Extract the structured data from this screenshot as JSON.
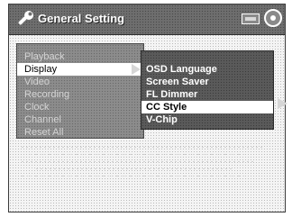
{
  "window": {
    "title": "General Setting",
    "icon": "wrench-icon",
    "indicators": [
      "disc-icon",
      "ring-icon"
    ]
  },
  "main_menu": {
    "items": [
      {
        "label": "Playback",
        "selected": false
      },
      {
        "label": "Display",
        "selected": true
      },
      {
        "label": "Video",
        "selected": false
      },
      {
        "label": "Recording",
        "selected": false
      },
      {
        "label": "Clock",
        "selected": false
      },
      {
        "label": "Channel",
        "selected": false
      },
      {
        "label": "Reset All",
        "selected": false
      }
    ]
  },
  "sub_menu": {
    "items": [
      {
        "label": "OSD Language",
        "selected": false
      },
      {
        "label": "Screen Saver",
        "selected": false
      },
      {
        "label": "FL Dimmer",
        "selected": false
      },
      {
        "label": "CC Style",
        "selected": true
      },
      {
        "label": "V-Chip",
        "selected": false
      }
    ]
  },
  "colors": {
    "title_bar": "#6e6e6e",
    "menu_panel": "#8c8c8c",
    "submenu_panel": "#5a5a5a",
    "highlight": "#ffffff"
  }
}
